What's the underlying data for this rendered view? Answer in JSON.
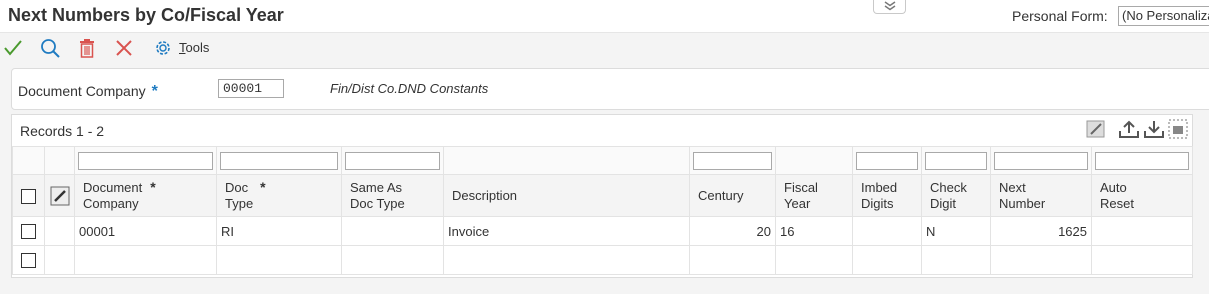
{
  "app": {
    "title": "Next Numbers by Co/Fiscal Year",
    "personal_form_label": "Personal Form:",
    "personal_form_value": "(No Personalization)"
  },
  "toolbar": {
    "tools_label_underlined": "T",
    "tools_label_rest": "ools"
  },
  "header": {
    "doc_company_label": "Document Company",
    "required_marker": "*",
    "doc_company_value": "00001",
    "doc_company_description": "Fin/Dist Co.DND Constants"
  },
  "grid": {
    "records_label": "Records 1 - 2",
    "required_marker": "*",
    "columns": [
      {
        "line1": "Document",
        "line2": "Company"
      },
      {
        "line1": "Doc",
        "line2": "Type"
      },
      {
        "line1": "Same As",
        "line2": "Doc Type"
      },
      {
        "line1": "Description",
        "line2": ""
      },
      {
        "line1": "Century",
        "line2": ""
      },
      {
        "line1": "Fiscal",
        "line2": "Year"
      },
      {
        "line1": "Imbed",
        "line2": "Digits"
      },
      {
        "line1": "Check",
        "line2": "Digit"
      },
      {
        "line1": "Next",
        "line2": "Number"
      },
      {
        "line1": "Auto",
        "line2": "Reset"
      }
    ],
    "rows": [
      {
        "doc_company": "00001",
        "doc_type": "RI",
        "same_as_doc_type": "",
        "description": "Invoice",
        "century": "20",
        "fiscal_year": "16",
        "imbed_digits": "",
        "check_digit": "N",
        "next_number": "1625",
        "auto_reset": ""
      },
      {
        "doc_company": "",
        "doc_type": "",
        "same_as_doc_type": "",
        "description": "",
        "century": "",
        "fiscal_year": "",
        "imbed_digits": "",
        "check_digit": "",
        "next_number": "",
        "auto_reset": ""
      }
    ]
  },
  "colors": {
    "ok_check": "#4a9a2e",
    "find": "#1f7bc1",
    "delete": "#d9534f",
    "cancel": "#d9534f",
    "required_star": "#1f7bc1"
  }
}
